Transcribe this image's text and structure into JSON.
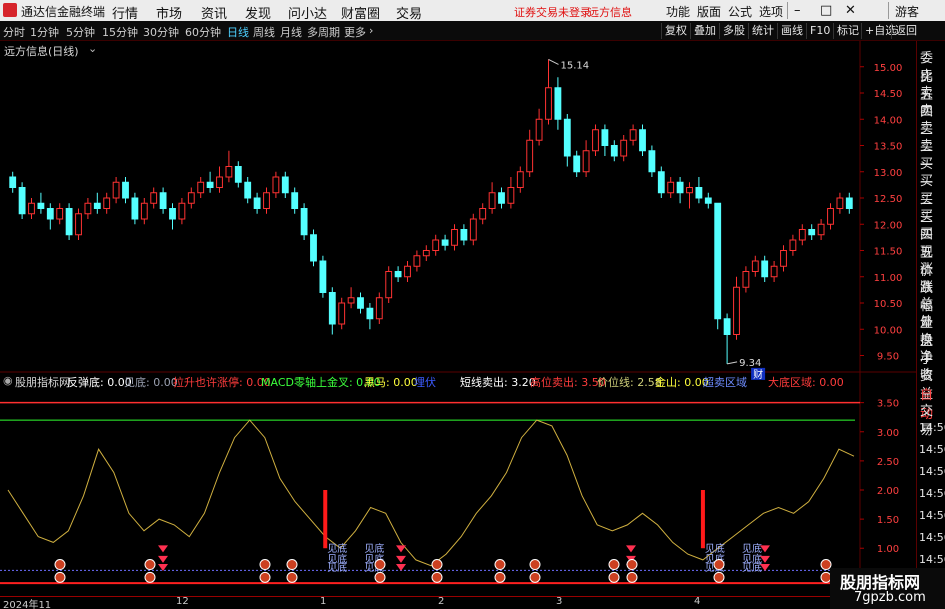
{
  "app": {
    "title": "通达信金融终端",
    "menu": [
      "行情",
      "市场",
      "资讯",
      "发现",
      "问小达",
      "财富圈",
      "交易"
    ],
    "notice": "证券交易未登录",
    "notice2": "远方信息",
    "right_menu": [
      "功能",
      "版面",
      "公式",
      "选项"
    ],
    "guest": "游客"
  },
  "periods": {
    "items": [
      "分时",
      "1分钟",
      "5分钟",
      "15分钟",
      "30分钟",
      "60分钟",
      "日线",
      "周线",
      "月线",
      "多周期",
      "更多"
    ],
    "active": "日线",
    "more_icon": "chevron-right-icon"
  },
  "toolbar": [
    "复权",
    "叠加",
    "多股",
    "统计",
    "画线",
    "F10",
    "标记",
    "+自选",
    "返回"
  ],
  "main": {
    "title": "远方信息(日线)",
    "price_axis": [
      "15.00",
      "14.50",
      "14.00",
      "13.50",
      "13.00",
      "12.50",
      "12.00",
      "11.50",
      "11.00",
      "10.50",
      "10.00",
      "9.50"
    ],
    "high_label": "15.14",
    "low_label": "9.34",
    "cai_badge": "财"
  },
  "side": [
    "委比",
    "卖五",
    "卖四",
    "卖三",
    "卖二",
    "卖一",
    "买一",
    "买二",
    "买三",
    "买四",
    "买五",
    "现价",
    "涨跌",
    "涨幅",
    "总量",
    "外盘",
    "换手",
    "净资",
    "收益"
  ],
  "side2": [
    "自动",
    "交易"
  ],
  "side2_times": [
    "14:56",
    "14:56",
    "14:56",
    "14:56",
    "14:56",
    "14:56",
    "14:56"
  ],
  "legend": [
    {
      "text": "股朋指标网",
      "color": "#d8d8d8"
    },
    {
      "text": "反弹底: 0.00",
      "color": "#ffffff"
    },
    {
      "text": "见底: 0.00",
      "color": "#9aa0b0"
    },
    {
      "text": "拉升也许涨停: 0.00",
      "color": "#ff3c3c"
    },
    {
      "text": "MACD零轴上金叉: 0.00",
      "color": "#3cff3c"
    },
    {
      "text": "黑马: 0.00",
      "color": "#ffff3c"
    },
    {
      "text": "埋伏",
      "color": "#3c5aff"
    },
    {
      "text": "短线卖出: 3.20",
      "color": "#ffffff"
    },
    {
      "text": "高位卖出: 3.50",
      "color": "#ff3c3c"
    },
    {
      "text": "价位线: 2.58",
      "color": "#cfcf7a"
    },
    {
      "text": "金山: 0.00",
      "color": "#ffff3c"
    },
    {
      "text": "超卖区域",
      "color": "#6e8cff"
    },
    {
      "text": "大底区域: 0.00",
      "color": "#ff3c3c"
    }
  ],
  "indicator": {
    "axis": [
      "3.50",
      "3.00",
      "2.50",
      "2.00",
      "1.50",
      "1.00",
      "0.50"
    ],
    "signal_label": "见底"
  },
  "dates": [
    "2024年11",
    "12",
    "1",
    "2",
    "3",
    "4"
  ],
  "watermark": {
    "line1": "股朋指标网",
    "line2": "7gpzb.com"
  },
  "colors": {
    "up": "#ff3232",
    "down": "#54ffff",
    "grid": "#5a0000",
    "ma": "#d0b040",
    "accent": "#4dd0ff"
  },
  "chart_data": [
    {
      "type": "candlestick",
      "title": "远方信息(日线)",
      "ylim": [
        9.3,
        15.3
      ],
      "annotations": [
        {
          "text": "15.14",
          "value": 15.14
        },
        {
          "text": "9.34",
          "value": 9.34
        }
      ],
      "candles": [
        [
          12.9,
          12.7,
          13.0,
          12.6
        ],
        [
          12.7,
          12.2,
          12.8,
          12.1
        ],
        [
          12.2,
          12.4,
          12.5,
          12.1
        ],
        [
          12.4,
          12.3,
          12.6,
          12.2
        ],
        [
          12.3,
          12.1,
          12.4,
          11.9
        ],
        [
          12.1,
          12.3,
          12.4,
          12.0
        ],
        [
          12.3,
          11.8,
          12.4,
          11.7
        ],
        [
          11.8,
          12.2,
          12.3,
          11.7
        ],
        [
          12.2,
          12.4,
          12.5,
          12.1
        ],
        [
          12.4,
          12.3,
          12.6,
          12.2
        ],
        [
          12.3,
          12.5,
          12.6,
          12.2
        ],
        [
          12.5,
          12.8,
          12.9,
          12.4
        ],
        [
          12.8,
          12.5,
          12.9,
          12.4
        ],
        [
          12.5,
          12.1,
          12.6,
          12.0
        ],
        [
          12.1,
          12.4,
          12.5,
          12.0
        ],
        [
          12.4,
          12.6,
          12.7,
          12.3
        ],
        [
          12.6,
          12.3,
          12.7,
          12.2
        ],
        [
          12.3,
          12.1,
          12.4,
          11.9
        ],
        [
          12.1,
          12.4,
          12.5,
          12.0
        ],
        [
          12.4,
          12.6,
          12.7,
          12.3
        ],
        [
          12.6,
          12.8,
          12.9,
          12.5
        ],
        [
          12.8,
          12.7,
          13.0,
          12.6
        ],
        [
          12.7,
          12.9,
          13.1,
          12.6
        ],
        [
          12.9,
          13.1,
          13.4,
          12.8
        ],
        [
          13.1,
          12.8,
          13.2,
          12.7
        ],
        [
          12.8,
          12.5,
          12.9,
          12.4
        ],
        [
          12.5,
          12.3,
          12.6,
          12.2
        ],
        [
          12.3,
          12.6,
          12.7,
          12.2
        ],
        [
          12.6,
          12.9,
          13.0,
          12.5
        ],
        [
          12.9,
          12.6,
          13.0,
          12.5
        ],
        [
          12.6,
          12.3,
          12.7,
          12.2
        ],
        [
          12.3,
          11.8,
          12.4,
          11.7
        ],
        [
          11.8,
          11.3,
          11.9,
          11.2
        ],
        [
          11.3,
          10.7,
          11.4,
          10.6
        ],
        [
          10.7,
          10.1,
          10.8,
          9.9
        ],
        [
          10.1,
          10.5,
          10.6,
          10.0
        ],
        [
          10.5,
          10.6,
          10.8,
          10.4
        ],
        [
          10.6,
          10.4,
          10.7,
          10.3
        ],
        [
          10.4,
          10.2,
          10.5,
          10.0
        ],
        [
          10.2,
          10.6,
          10.7,
          10.1
        ],
        [
          10.6,
          11.1,
          11.2,
          10.5
        ],
        [
          11.1,
          11.0,
          11.2,
          10.9
        ],
        [
          11.0,
          11.2,
          11.3,
          10.9
        ],
        [
          11.2,
          11.4,
          11.5,
          11.1
        ],
        [
          11.4,
          11.5,
          11.6,
          11.3
        ],
        [
          11.5,
          11.7,
          11.8,
          11.4
        ],
        [
          11.7,
          11.6,
          11.8,
          11.5
        ],
        [
          11.6,
          11.9,
          12.0,
          11.5
        ],
        [
          11.9,
          11.7,
          12.0,
          11.6
        ],
        [
          11.7,
          12.1,
          12.2,
          11.6
        ],
        [
          12.1,
          12.3,
          12.4,
          12.0
        ],
        [
          12.3,
          12.6,
          12.8,
          12.2
        ],
        [
          12.6,
          12.4,
          12.7,
          12.3
        ],
        [
          12.4,
          12.7,
          12.9,
          12.3
        ],
        [
          12.7,
          13.0,
          13.1,
          12.6
        ],
        [
          13.0,
          13.6,
          13.8,
          12.9
        ],
        [
          13.6,
          14.0,
          14.2,
          13.5
        ],
        [
          14.0,
          14.6,
          15.14,
          13.9
        ],
        [
          14.6,
          14.0,
          14.8,
          13.8
        ],
        [
          14.0,
          13.3,
          14.1,
          13.1
        ],
        [
          13.3,
          13.0,
          13.4,
          12.9
        ],
        [
          13.0,
          13.4,
          13.6,
          12.9
        ],
        [
          13.4,
          13.8,
          13.9,
          13.3
        ],
        [
          13.8,
          13.5,
          13.9,
          13.3
        ],
        [
          13.5,
          13.3,
          13.6,
          13.2
        ],
        [
          13.3,
          13.6,
          13.7,
          13.2
        ],
        [
          13.6,
          13.8,
          13.9,
          13.5
        ],
        [
          13.8,
          13.4,
          13.9,
          13.3
        ],
        [
          13.4,
          13.0,
          13.5,
          12.9
        ],
        [
          13.0,
          12.6,
          13.1,
          12.5
        ],
        [
          12.6,
          12.8,
          12.9,
          12.5
        ],
        [
          12.8,
          12.6,
          12.9,
          12.4
        ],
        [
          12.6,
          12.7,
          12.8,
          12.3
        ],
        [
          12.7,
          12.5,
          12.9,
          12.4
        ],
        [
          12.5,
          12.4,
          12.6,
          12.3
        ],
        [
          12.4,
          10.2,
          12.4,
          10.0
        ],
        [
          10.2,
          9.9,
          10.3,
          9.34
        ],
        [
          9.9,
          10.8,
          11.0,
          9.8
        ],
        [
          10.8,
          11.1,
          11.2,
          10.7
        ],
        [
          11.1,
          11.3,
          11.4,
          11.0
        ],
        [
          11.3,
          11.0,
          11.4,
          10.9
        ],
        [
          11.0,
          11.2,
          11.3,
          10.9
        ],
        [
          11.2,
          11.5,
          11.6,
          11.1
        ],
        [
          11.5,
          11.7,
          11.8,
          11.4
        ],
        [
          11.7,
          11.9,
          12.0,
          11.6
        ],
        [
          11.9,
          11.8,
          12.0,
          11.7
        ],
        [
          11.8,
          12.0,
          12.1,
          11.7
        ],
        [
          12.0,
          12.3,
          12.4,
          11.9
        ],
        [
          12.3,
          12.5,
          12.6,
          12.2
        ],
        [
          12.5,
          12.3,
          12.6,
          12.2
        ]
      ]
    },
    {
      "type": "line",
      "title": "股朋指标网",
      "ylim": [
        0.3,
        3.7
      ],
      "hlines": [
        3.2,
        3.5
      ],
      "series": [
        {
          "name": "价位线",
          "values": [
            2.0,
            1.6,
            1.2,
            1.1,
            1.3,
            1.9,
            2.7,
            2.3,
            1.6,
            1.3,
            1.5,
            1.4,
            1.2,
            1.6,
            2.3,
            2.9,
            3.2,
            2.9,
            2.2,
            1.8,
            1.5,
            1.2,
            1.0,
            1.3,
            1.7,
            1.6,
            1.1,
            0.8,
            0.7,
            0.9,
            1.2,
            1.6,
            1.9,
            2.3,
            2.9,
            3.2,
            3.1,
            2.6,
            1.9,
            1.4,
            1.3,
            1.4,
            1.6,
            1.4,
            1.1,
            0.9,
            0.8,
            1.0,
            1.2,
            1.4,
            1.6,
            1.7,
            1.6,
            1.8,
            2.2,
            2.7,
            2.58
          ]
        }
      ],
      "signals": [
        {
          "name": "见底",
          "x_index": [
            21,
            22,
            46,
            47
          ]
        }
      ]
    }
  ]
}
